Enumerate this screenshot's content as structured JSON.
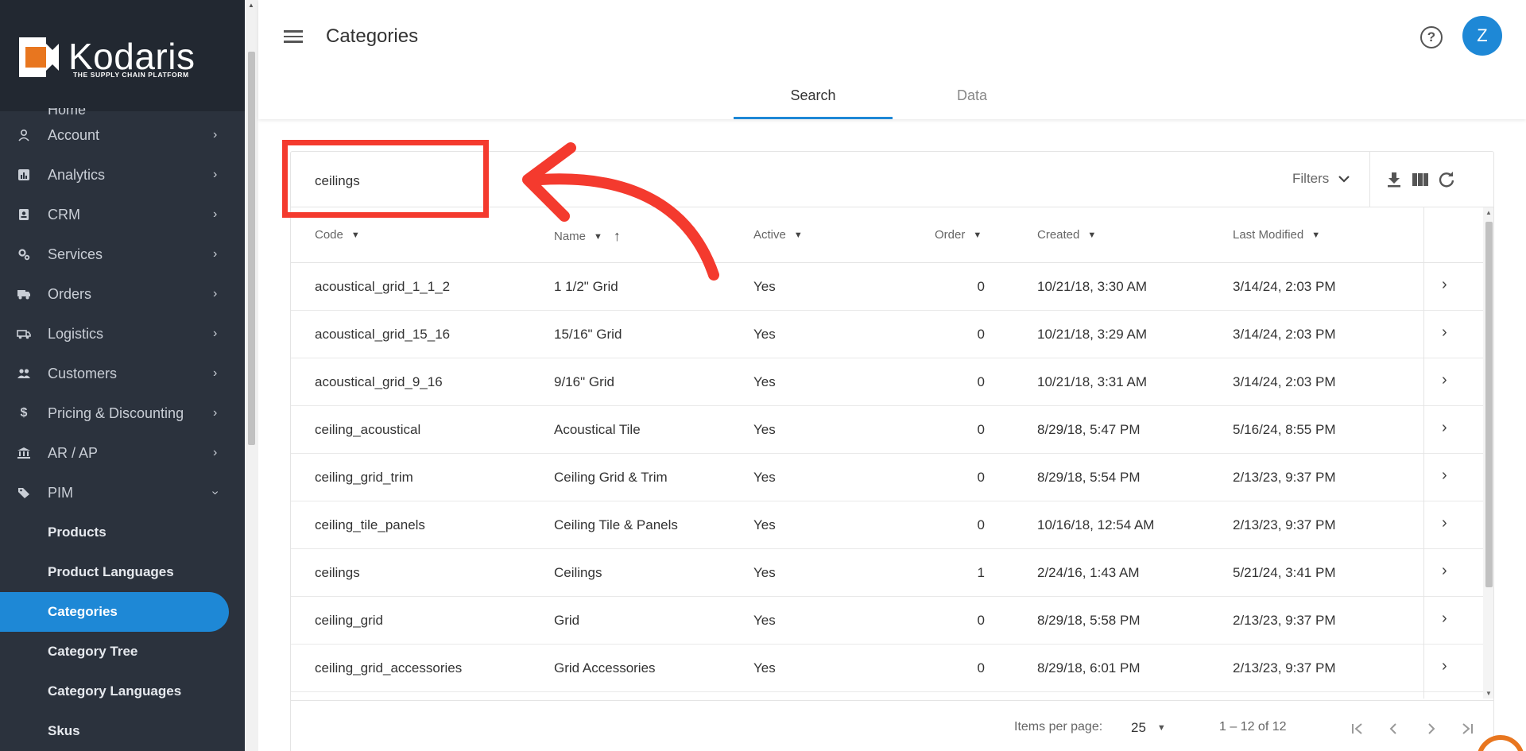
{
  "brand": {
    "name": "Kodaris",
    "tagline": "THE SUPPLY CHAIN PLATFORM"
  },
  "sidebar": {
    "partial_item": "Home",
    "items": [
      {
        "label": "Account",
        "icon": "person-icon"
      },
      {
        "label": "Analytics",
        "icon": "analytics-icon"
      },
      {
        "label": "CRM",
        "icon": "crm-icon"
      },
      {
        "label": "Services",
        "icon": "services-icon"
      },
      {
        "label": "Orders",
        "icon": "truck-icon"
      },
      {
        "label": "Logistics",
        "icon": "logistics-icon"
      },
      {
        "label": "Customers",
        "icon": "people-icon"
      },
      {
        "label": "Pricing & Discounting",
        "icon": "dollar-icon"
      },
      {
        "label": "AR / AP",
        "icon": "bank-icon"
      },
      {
        "label": "PIM",
        "icon": "tag-icon"
      }
    ],
    "sub_items": [
      {
        "label": "Products"
      },
      {
        "label": "Product Languages"
      },
      {
        "label": "Categories"
      },
      {
        "label": "Category Tree"
      },
      {
        "label": "Category Languages"
      },
      {
        "label": "Skus"
      }
    ],
    "active": "Categories"
  },
  "header": {
    "title": "Categories",
    "avatar_initial": "Z",
    "help_glyph": "?"
  },
  "tabs": [
    {
      "label": "Search",
      "active": true
    },
    {
      "label": "Data",
      "active": false
    }
  ],
  "toolbar": {
    "search_value": "ceilings",
    "filters_label": "Filters"
  },
  "table": {
    "columns": [
      "Code",
      "Name",
      "Active",
      "Order",
      "Created",
      "Last Modified"
    ],
    "sorted_column": "Name",
    "rows": [
      {
        "code": "acoustical_grid_1_1_2",
        "name": "1 1/2\" Grid",
        "active": "Yes",
        "order": "0",
        "created": "10/21/18, 3:30 AM",
        "modified": "3/14/24, 2:03 PM"
      },
      {
        "code": "acoustical_grid_15_16",
        "name": "15/16\" Grid",
        "active": "Yes",
        "order": "0",
        "created": "10/21/18, 3:29 AM",
        "modified": "3/14/24, 2:03 PM"
      },
      {
        "code": "acoustical_grid_9_16",
        "name": "9/16\" Grid",
        "active": "Yes",
        "order": "0",
        "created": "10/21/18, 3:31 AM",
        "modified": "3/14/24, 2:03 PM"
      },
      {
        "code": "ceiling_acoustical",
        "name": "Acoustical Tile",
        "active": "Yes",
        "order": "0",
        "created": "8/29/18, 5:47 PM",
        "modified": "5/16/24, 8:55 PM"
      },
      {
        "code": "ceiling_grid_trim",
        "name": "Ceiling Grid & Trim",
        "active": "Yes",
        "order": "0",
        "created": "8/29/18, 5:54 PM",
        "modified": "2/13/23, 9:37 PM"
      },
      {
        "code": "ceiling_tile_panels",
        "name": "Ceiling Tile & Panels",
        "active": "Yes",
        "order": "0",
        "created": "10/16/18, 12:54 AM",
        "modified": "2/13/23, 9:37 PM"
      },
      {
        "code": "ceilings",
        "name": "Ceilings",
        "active": "Yes",
        "order": "1",
        "created": "2/24/16, 1:43 AM",
        "modified": "5/21/24, 3:41 PM"
      },
      {
        "code": "ceiling_grid",
        "name": "Grid",
        "active": "Yes",
        "order": "0",
        "created": "8/29/18, 5:58 PM",
        "modified": "2/13/23, 9:37 PM"
      },
      {
        "code": "ceiling_grid_accessories",
        "name": "Grid Accessories",
        "active": "Yes",
        "order": "0",
        "created": "8/29/18, 6:01 PM",
        "modified": "2/13/23, 9:37 PM"
      }
    ]
  },
  "paginator": {
    "items_per_page_label": "Items per page:",
    "page_size": "25",
    "range_label": "1 – 12 of 12"
  },
  "colors": {
    "accent": "#1e88d6",
    "sidebar_bg": "#2b323d",
    "annotation": "#f43a2e",
    "logo_orange": "#e8761f"
  }
}
